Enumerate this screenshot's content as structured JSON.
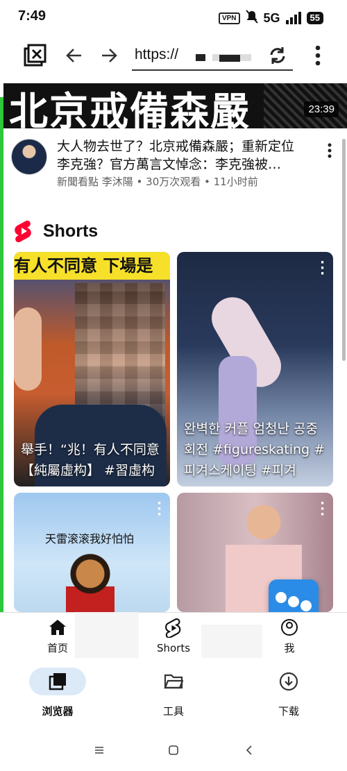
{
  "status_bar": {
    "time": "7:49",
    "vpn": "VPN",
    "network": "5G",
    "battery": "55"
  },
  "browser_toolbar": {
    "url": "https://",
    "icons": [
      "tabs-close-icon",
      "back-arrow-icon",
      "forward-arrow-icon",
      "refresh-icon",
      "more-vert-icon"
    ]
  },
  "video": {
    "thumbnail_text": "北京戒備森嚴",
    "duration": "23:39",
    "title": "大人物去世了？北京戒備森嚴；重新定位李克強？官方萬言文悼念：李克強被…",
    "meta": "新聞看點 李沐陽 • 30万次观看 • 11小时前"
  },
  "shorts": {
    "section_label": "Shorts",
    "cards": [
      {
        "banner": "有人不同意 下場是",
        "caption": "舉手！“兆！有人不同意【純屬虛构】 #習虛构"
      },
      {
        "caption": "완벽한 커플 엄청난 공중회전 #figureskating #피겨스케이팅 #피겨"
      },
      {
        "overlay_text": "天雷滚滚我好怕怕"
      },
      {
        "overlay_text": ""
      }
    ]
  },
  "yt_nav": {
    "home": "首页",
    "shorts": "Shorts",
    "me": "我"
  },
  "browser_nav": {
    "browser": "浏览器",
    "tools": "工具",
    "downloads": "下载"
  },
  "colors": {
    "accent_green": "#2ec63a",
    "shorts_red": "#ff0033",
    "float_blue": "#2a8ce6",
    "pill_blue": "#dceaf8"
  }
}
